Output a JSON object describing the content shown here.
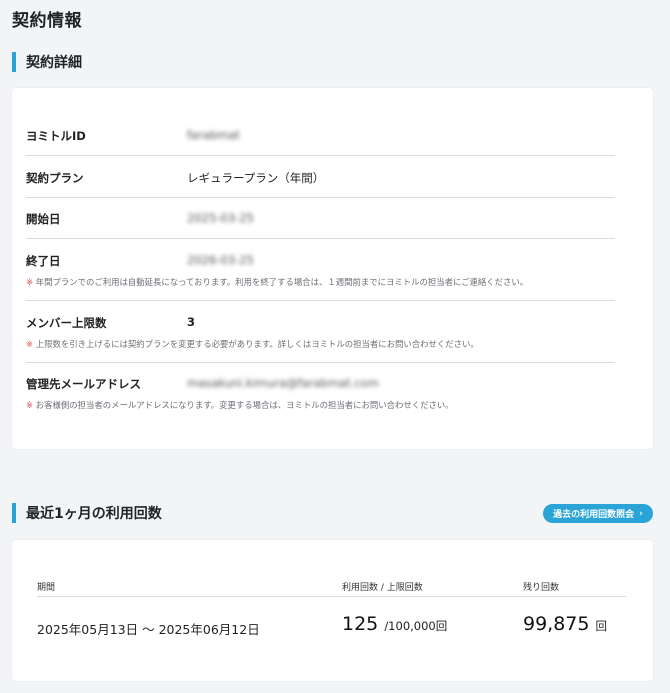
{
  "page": {
    "title": "契約情報"
  },
  "contract": {
    "heading": "契約詳細",
    "rows": [
      {
        "label": "ヨミトルID",
        "value": "farabmat",
        "blurred": true
      },
      {
        "label": "契約プラン",
        "value": "レギュラープラン（年間）",
        "blurred": false
      },
      {
        "label": "開始日",
        "value": "2025-03-25",
        "blurred": true
      },
      {
        "label": "終了日",
        "value": "2026-03-25",
        "blurred": true,
        "note": "年間プランでのご利用は自動延長になっております。利用を終了する場合は、１週間前までにヨミトルの担当者にご連絡ください。"
      },
      {
        "label": "メンバー上限数",
        "value": "3",
        "blurred": false,
        "note": "上限数を引き上げるには契約プランを変更する必要があります。詳しくはヨミトルの担当者にお問い合わせください。"
      },
      {
        "label": "管理先メールアドレス",
        "value": "masakuni.kimura@farabmat.com",
        "blurred": true,
        "note": "お客様側の担当者のメールアドレスになります。変更する場合は、ヨミトルの担当者にお問い合わせください。"
      }
    ],
    "note_marker": "※"
  },
  "usage": {
    "heading": "最近1ヶ月の利用回数",
    "history_button": "過去の利用回数照会",
    "history_chevron": "›",
    "columns": {
      "period": "期間",
      "usage_limit": "利用回数 / 上限回数",
      "remaining": "残り回数"
    },
    "period_value": "2025年05月13日 〜 2025年06月12日",
    "used": "125",
    "limit": "/100,000回",
    "remaining": "99,875",
    "remaining_unit": "回"
  },
  "colors": {
    "accent": "#2aa3d6",
    "note_marker": "#e0505a"
  }
}
